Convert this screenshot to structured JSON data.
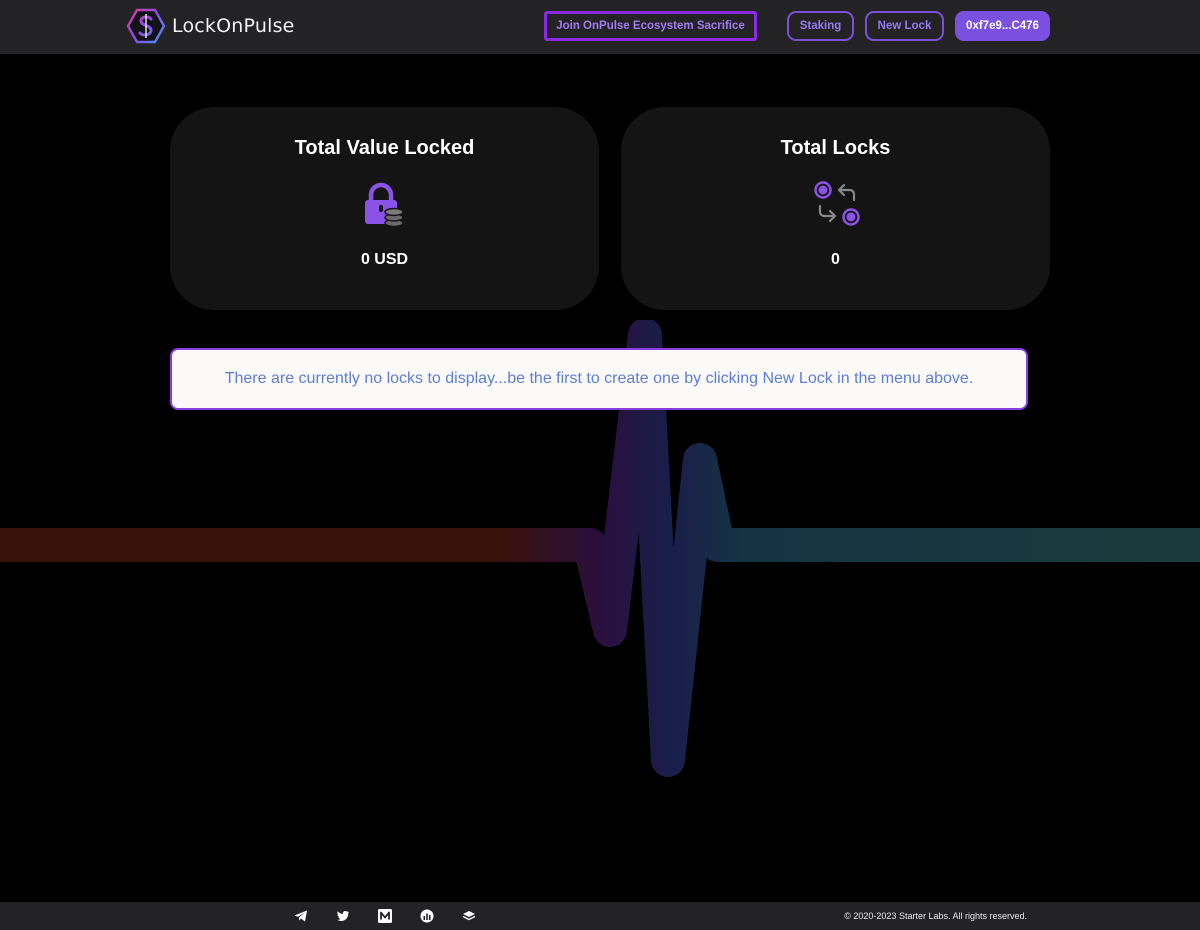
{
  "header": {
    "brand_name": "LockOnPulse",
    "nav": {
      "sacrifice_label": "Join OnPulse Ecosystem Sacrifice",
      "staking_label": "Staking",
      "new_lock_label": "New Lock",
      "wallet_label": "0xf7e9...C476"
    }
  },
  "stats": {
    "tvl": {
      "title": "Total Value Locked",
      "value": "0 USD",
      "icon": "lock-coins-icon"
    },
    "locks": {
      "title": "Total Locks",
      "value": "0",
      "icon": "swap-arrows-icon"
    }
  },
  "empty_state": {
    "message": "There are currently no locks to display...be the first to create one by clicking New Lock in the menu above."
  },
  "footer": {
    "social_icons": [
      "telegram-icon",
      "twitter-icon",
      "medium-icon",
      "chart-icon",
      "docs-icon"
    ],
    "copyright": "© 2020-2023 Starter Labs. All rights reserved."
  },
  "colors": {
    "accent": "#7b4fe0",
    "header_bg": "#232326",
    "card_bg": "#141414",
    "message_text": "#5d7ed6"
  }
}
